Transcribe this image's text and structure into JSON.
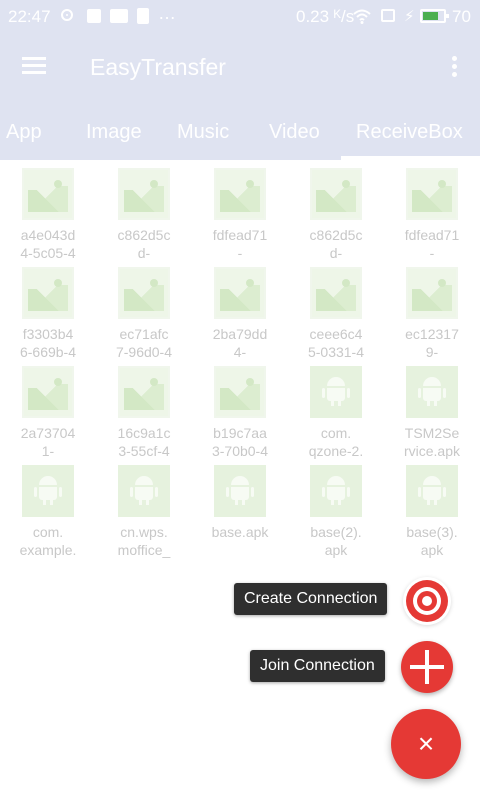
{
  "status_bar": {
    "time": "22:47",
    "speed": "0.23 ᴷ/s",
    "battery_level": "70",
    "more_icon": "…"
  },
  "toolbar": {
    "title": "EasyTransfer"
  },
  "tabs": [
    {
      "label": "App"
    },
    {
      "label": "Image"
    },
    {
      "label": "Music"
    },
    {
      "label": "Video"
    },
    {
      "label": "ReceiveBox",
      "selected": true
    }
  ],
  "files": [
    {
      "type": "image",
      "line1": "a4e043d",
      "line2": "4-5c05-4"
    },
    {
      "type": "image",
      "line1": "c862d5c",
      "line2": "d-"
    },
    {
      "type": "image",
      "line1": "fdfead71",
      "line2": "-"
    },
    {
      "type": "image",
      "line1": "c862d5c",
      "line2": "d-"
    },
    {
      "type": "image",
      "line1": "fdfead71",
      "line2": "-"
    },
    {
      "type": "image",
      "line1": "f3303b4",
      "line2": "6-669b-4"
    },
    {
      "type": "image",
      "line1": "ec71afc",
      "line2": "7-96d0-4"
    },
    {
      "type": "image",
      "line1": "2ba79dd",
      "line2": "4-"
    },
    {
      "type": "image",
      "line1": "ceee6c4",
      "line2": "5-0331-4"
    },
    {
      "type": "image",
      "line1": "ec12317",
      "line2": "9-"
    },
    {
      "type": "image",
      "line1": "2a73704",
      "line2": "1-"
    },
    {
      "type": "image",
      "line1": "16c9a1c",
      "line2": "3-55cf-4"
    },
    {
      "type": "image",
      "line1": "b19c7aa",
      "line2": "3-70b0-4"
    },
    {
      "type": "apk",
      "line1": "com.",
      "line2": "qzone-2."
    },
    {
      "type": "apk",
      "line1": "TSM2Se",
      "line2": "rvice.apk"
    },
    {
      "type": "apk",
      "line1": "com.",
      "line2": "example."
    },
    {
      "type": "apk",
      "line1": "cn.wps.",
      "line2": "moffice_"
    },
    {
      "type": "apk",
      "line1": "base.apk",
      "line2": ""
    },
    {
      "type": "apk",
      "line1": "base(2).",
      "line2": "apk"
    },
    {
      "type": "apk",
      "line1": "base(3).",
      "line2": "apk"
    }
  ],
  "fab": {
    "create_label": "Create Connection",
    "join_label": "Join Connection",
    "close_symbol": "×"
  },
  "colors": {
    "toolbar_bg": "#dfe3f1",
    "accent_red": "#e53935",
    "label_bg": "#2f2f2f"
  },
  "icons": [
    "menu-icon",
    "overflow-icon",
    "image-icon",
    "android-icon",
    "hotspot-icon",
    "plus-icon",
    "close-icon"
  ]
}
